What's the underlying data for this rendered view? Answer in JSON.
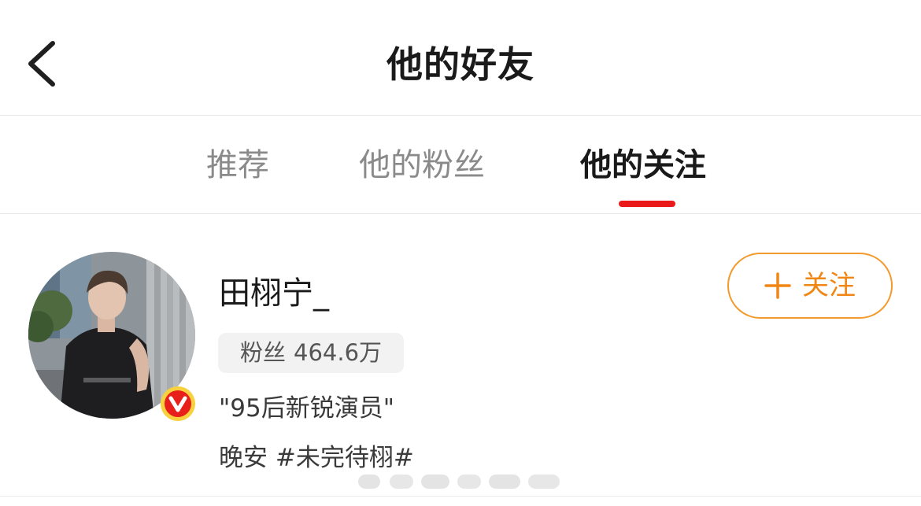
{
  "header": {
    "title": "他的好友",
    "back_icon": "chevron-left-icon"
  },
  "tabs": [
    {
      "label": "推荐",
      "active": false
    },
    {
      "label": "他的粉丝",
      "active": false
    },
    {
      "label": "他的关注",
      "active": true
    }
  ],
  "colors": {
    "accent_orange": "#f08614",
    "tab_indicator": "#ea1a1a",
    "verified_badge": "#e8201c"
  },
  "users": [
    {
      "name": "田栩宁_",
      "fans_label": "粉丝",
      "fans_count": "464.6万",
      "bio": "\"95后新锐演员\"",
      "status": "晚安 #未完待栩#",
      "verified": true,
      "follow_label": "关注",
      "follow_icon": "plus-icon"
    }
  ]
}
